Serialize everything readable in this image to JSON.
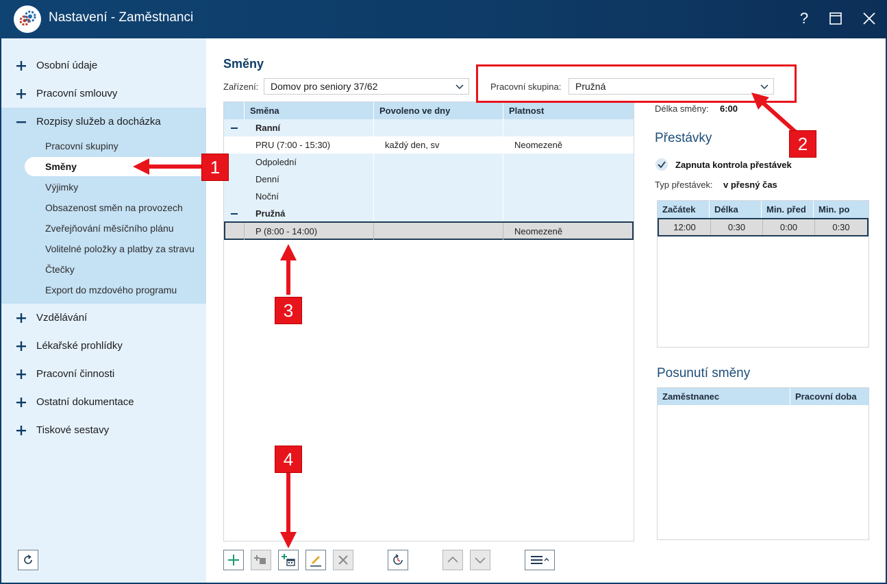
{
  "window": {
    "title": "Nastavení - Zaměstnanci",
    "help": "?"
  },
  "sidebar": {
    "items_top": [
      {
        "label": "Osobní údaje",
        "state": "plus"
      },
      {
        "label": "Pracovní smlouvy",
        "state": "plus"
      },
      {
        "label": "Rozpisy služeb a docházka",
        "state": "minus"
      }
    ],
    "sub_items": [
      "Pracovní skupiny",
      "Směny",
      "Výjimky",
      "Obsazenost směn na provozech",
      "Zveřejňování měsíčního plánu",
      "Volitelné položky a platby za stravu",
      "Čtečky",
      "Export do mzdového programu"
    ],
    "active_sub": "Směny",
    "items_bottom": [
      {
        "label": "Vzdělávání"
      },
      {
        "label": "Lékařské prohlídky"
      },
      {
        "label": "Pracovní činnosti"
      },
      {
        "label": "Ostatní dokumentace"
      },
      {
        "label": "Tiskové sestavy"
      }
    ]
  },
  "main": {
    "title": "Směny",
    "facility_label": "Zařízení:",
    "facility_value": "Domov pro seniory 37/62",
    "group_label": "Pracovní skupina:",
    "group_value": "Pružná",
    "columns": [
      "Směna",
      "Povoleno ve dny",
      "Platnost"
    ],
    "groups": [
      {
        "name": "Ranní",
        "rows": [
          {
            "name": "PRU (7:00 - 15:30)",
            "days": "každý den, sv",
            "validity": "Neomezeně"
          },
          {
            "name": "Odpolední",
            "days": "",
            "validity": ""
          },
          {
            "name": "Denní",
            "days": "",
            "validity": ""
          },
          {
            "name": "Noční",
            "days": "",
            "validity": ""
          }
        ]
      },
      {
        "name": "Pružná",
        "rows": [
          {
            "name": "P (8:00 - 14:00)",
            "days": "",
            "validity": "Neomezeně",
            "selected": true
          }
        ]
      }
    ]
  },
  "right": {
    "shift_length_label": "Délka směny:",
    "shift_length_value": "6:00",
    "breaks_title": "Přestávky",
    "breaks_check_label": "Zapnuta kontrola přestávek",
    "breaks_check": true,
    "break_type_label": "Typ přestávek:",
    "break_type_value": "v přesný čas",
    "breaks_columns": [
      "Začátek",
      "Délka",
      "Min. před",
      "Min. po"
    ],
    "breaks_rows": [
      [
        "12:00",
        "0:30",
        "0:00",
        "0:30"
      ]
    ],
    "shift_move_title": "Posunutí směny",
    "shift_move_columns": [
      "Zaměstnanec",
      "Pracovní doba"
    ]
  },
  "annotations": [
    "1",
    "2",
    "3",
    "4"
  ],
  "colors": {
    "titlebar": "#0f4372",
    "accent": "#0e3c66",
    "sidebar": "#e6f2fb",
    "sidebar_open": "#c5e1f4",
    "header": "#c4e0f3",
    "annotation": "#e8141c"
  }
}
